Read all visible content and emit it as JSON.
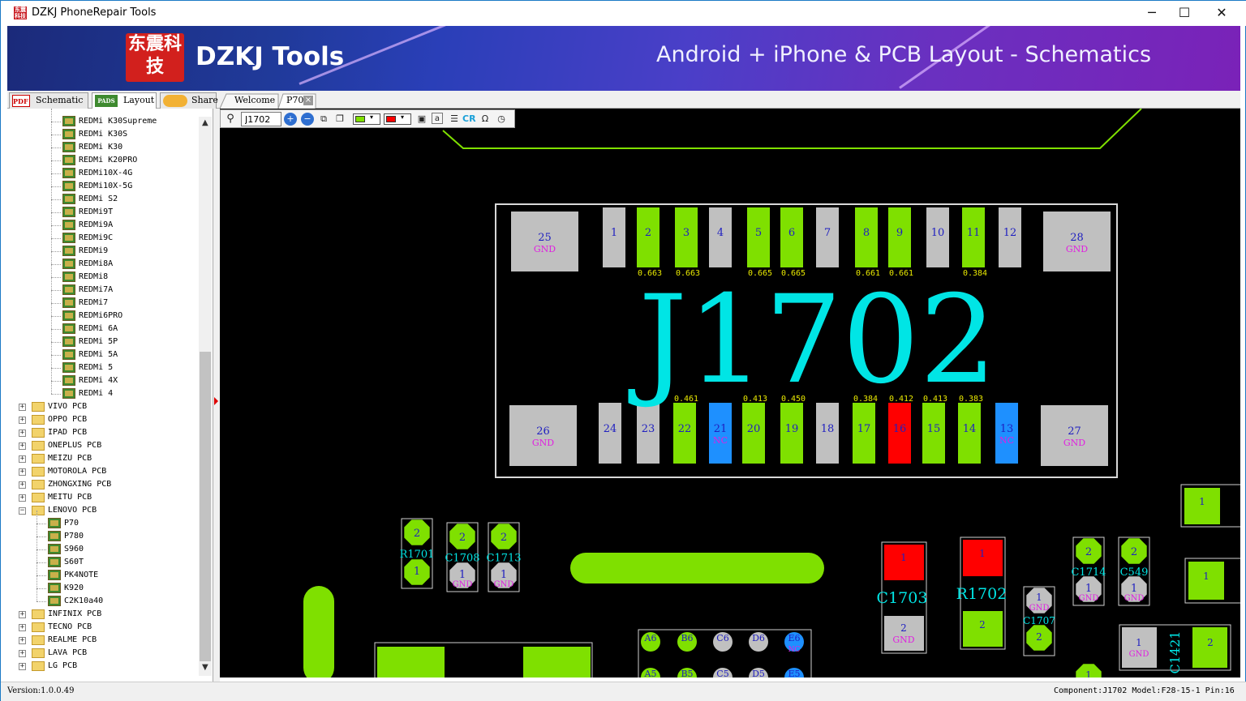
{
  "window": {
    "title": "DZKJ PhoneRepair Tools",
    "icon_text": "东震科技",
    "controls": [
      "─",
      "☐",
      "✕"
    ]
  },
  "banner": {
    "logo_text": "东震科技",
    "brand": "DZKJ Tools",
    "tagline": "Android + iPhone & PCB Layout - Schematics"
  },
  "mode_tabs": [
    {
      "label": "Schematic",
      "icon": "PDF"
    },
    {
      "label": "Layout",
      "icon": "PADS"
    },
    {
      "label": "Share",
      "icon": "cloud-icon"
    }
  ],
  "doc_tabs": [
    {
      "label": "Welcome"
    },
    {
      "label": "P70"
    }
  ],
  "tree": {
    "redmi_items": [
      "REDMi K30Supreme",
      "REDMi K30S",
      "REDMi K30",
      "REDMi K20PRO",
      "REDMi10X-4G",
      "REDMi10X-5G",
      "REDMi S2",
      "REDMi9T",
      "REDMi9A",
      "REDMi9C",
      "REDMi9",
      "REDMi8A",
      "REDMi8",
      "REDMi7A",
      "REDMi7",
      "REDMi6PRO",
      "REDMi 6A",
      "REDMi 5P",
      "REDMi 5A",
      "REDMi 5",
      "REDMi 4X",
      "REDMi 4"
    ],
    "folders_a": [
      "VIVO PCB",
      "OPPO PCB",
      "IPAD PCB",
      "ONEPLUS PCB",
      "MEIZU PCB",
      "MOTOROLA PCB",
      "ZHONGXING PCB",
      "MEITU PCB"
    ],
    "lenovo": {
      "label": "LENOVO PCB",
      "items": [
        "P70",
        "P780",
        "S960",
        "S60T",
        "PK4NOTE",
        "K920",
        "C2K10a40"
      ]
    },
    "folders_b": [
      "INFINIX PCB",
      "TECNO PCB",
      "REALME PCB",
      "LAVA PCB",
      "LG PCB"
    ]
  },
  "pcb_toolbar": {
    "search_value": "J1702",
    "fill_color": "#7fe000",
    "highlight_color": "#ff0000",
    "cr_label": "CR",
    "omega_label": "Ω"
  },
  "board": {
    "component_label": "J1702",
    "top_pins": [
      {
        "num": "25",
        "net": "GND",
        "color": "gray",
        "volt": ""
      },
      {
        "num": "1",
        "net": "",
        "color": "gray",
        "volt": ""
      },
      {
        "num": "2",
        "net": "",
        "color": "green",
        "volt": "0.663"
      },
      {
        "num": "3",
        "net": "",
        "color": "green",
        "volt": "0.663"
      },
      {
        "num": "4",
        "net": "",
        "color": "gray",
        "volt": ""
      },
      {
        "num": "5",
        "net": "",
        "color": "green",
        "volt": "0.665"
      },
      {
        "num": "6",
        "net": "",
        "color": "green",
        "volt": "0.665"
      },
      {
        "num": "7",
        "net": "",
        "color": "gray",
        "volt": ""
      },
      {
        "num": "8",
        "net": "",
        "color": "green",
        "volt": "0.661"
      },
      {
        "num": "9",
        "net": "",
        "color": "green",
        "volt": "0.661"
      },
      {
        "num": "10",
        "net": "",
        "color": "gray",
        "volt": ""
      },
      {
        "num": "11",
        "net": "",
        "color": "green",
        "volt": "0.384"
      },
      {
        "num": "12",
        "net": "",
        "color": "gray",
        "volt": ""
      },
      {
        "num": "28",
        "net": "GND",
        "color": "gray",
        "volt": ""
      }
    ],
    "bottom_pins": [
      {
        "num": "26",
        "net": "GND",
        "color": "gray",
        "volt": ""
      },
      {
        "num": "24",
        "net": "",
        "color": "gray",
        "volt": ""
      },
      {
        "num": "23",
        "net": "",
        "color": "gray",
        "volt": ""
      },
      {
        "num": "22",
        "net": "",
        "color": "green",
        "volt": "0.461"
      },
      {
        "num": "21",
        "net": "NC",
        "color": "blue",
        "volt": ""
      },
      {
        "num": "20",
        "net": "",
        "color": "green",
        "volt": "0.413"
      },
      {
        "num": "19",
        "net": "",
        "color": "green",
        "volt": "0.450"
      },
      {
        "num": "18",
        "net": "",
        "color": "gray",
        "volt": ""
      },
      {
        "num": "17",
        "net": "",
        "color": "green",
        "volt": "0.384"
      },
      {
        "num": "16",
        "net": "",
        "color": "red",
        "volt": "0.412"
      },
      {
        "num": "15",
        "net": "",
        "color": "green",
        "volt": "0.413"
      },
      {
        "num": "14",
        "net": "",
        "color": "green",
        "volt": "0.383"
      },
      {
        "num": "13",
        "net": "NC",
        "color": "blue",
        "volt": ""
      },
      {
        "num": "27",
        "net": "GND",
        "color": "gray",
        "volt": ""
      }
    ],
    "parts": {
      "r1701": "R1701",
      "c1708": "C1708",
      "c1713": "C1713",
      "c1703": "C1703",
      "r1702": "R1702",
      "c1707": "C1707",
      "c1714": "C1714",
      "c549": "C549",
      "c1421": "C1421",
      "gnd": "GND",
      "one": "1",
      "two": "2"
    },
    "bga_labels": [
      "A6",
      "B6",
      "C6",
      "D6",
      "E6",
      "A5",
      "B5",
      "C5",
      "D5",
      "E5"
    ],
    "bga_nc": "NC"
  },
  "status": {
    "version": "Version:1.0.0.49",
    "component_info": "Component:J1702 Model:F28-15-1 Pin:16"
  },
  "colors": {
    "pad_green": "#7fe000",
    "pad_gray": "#c0c0c0",
    "pad_red": "#ff0000",
    "pad_blue": "#1e90ff",
    "label_cyan": "#00e5e5",
    "pin_num": "#2020c0",
    "net_magenta": "#e020e0",
    "volt_yellow": "#e8e800"
  }
}
